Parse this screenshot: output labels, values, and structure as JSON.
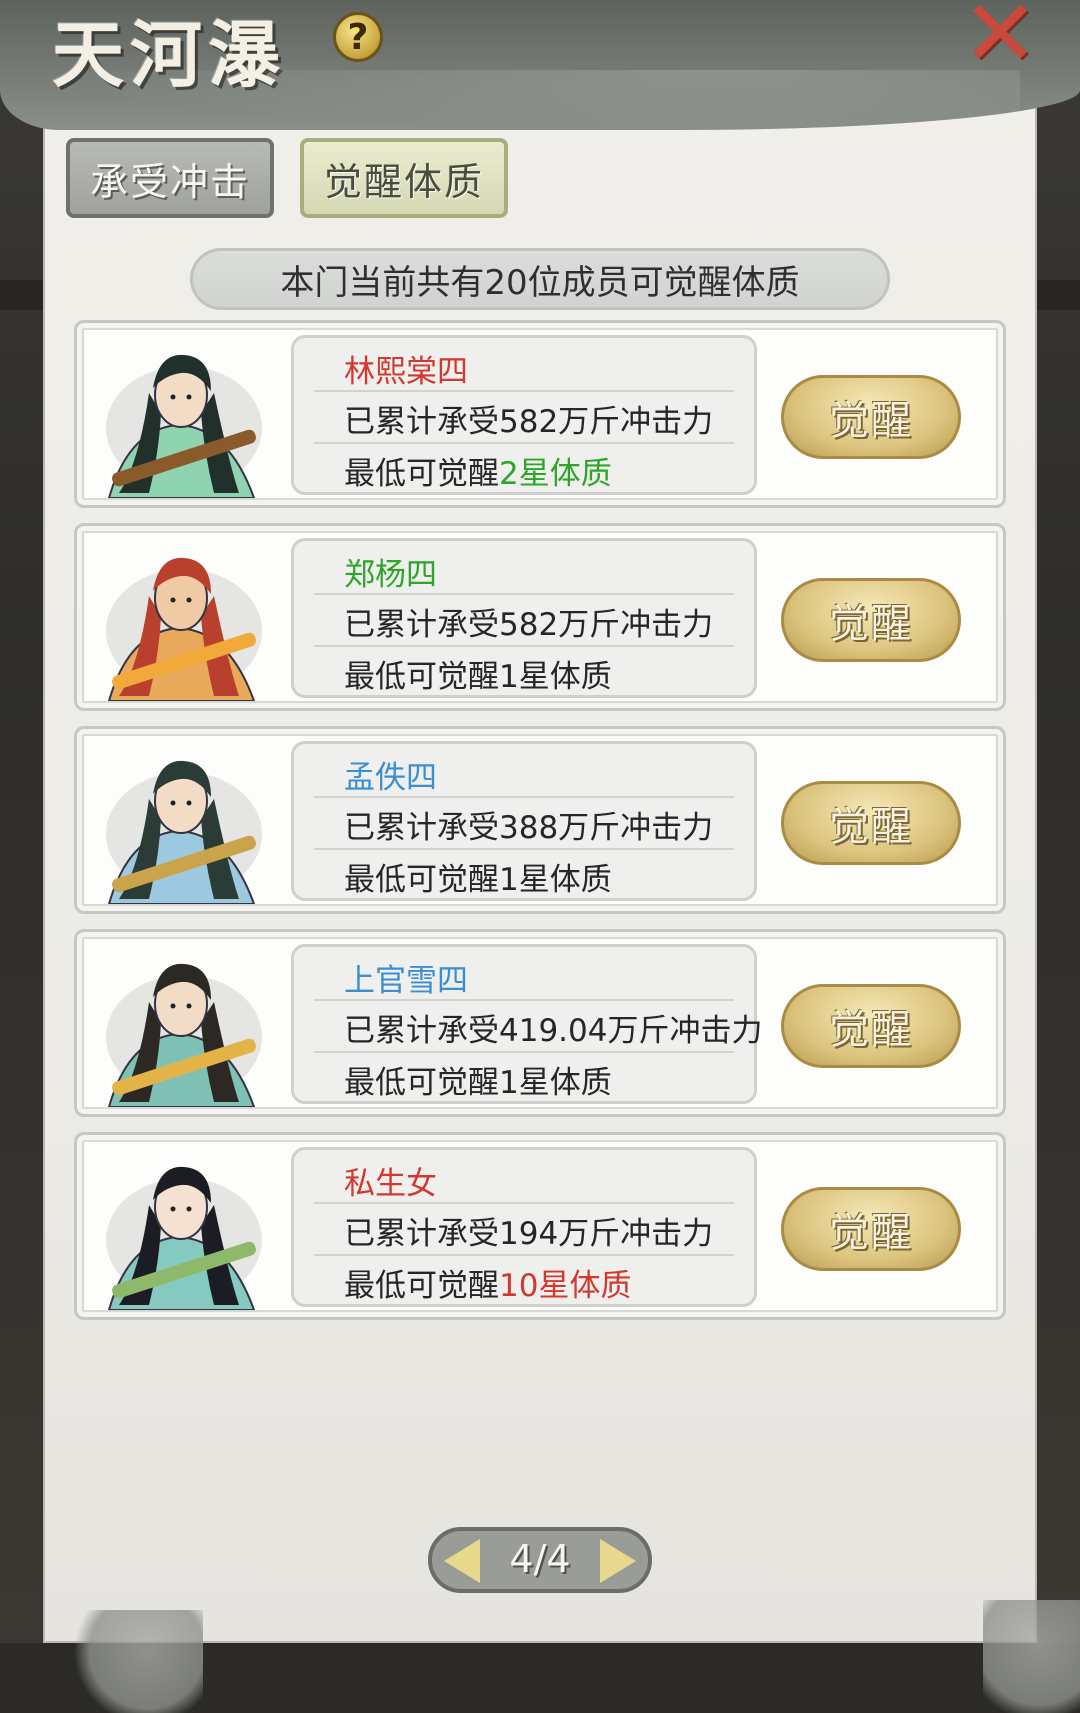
{
  "header": {
    "title": "天河瀑",
    "help_glyph": "?",
    "close_glyph": "✕"
  },
  "tabs": [
    {
      "label": "承受冲击",
      "selected": false
    },
    {
      "label": "觉醒体质",
      "selected": true
    }
  ],
  "summary": "本门当前共有20位成员可觉醒体质",
  "members": [
    {
      "name": "林熙棠四",
      "name_color": "#d2382e",
      "impact_prefix": "已累计承受",
      "impact_value": "582万斤",
      "impact_suffix": "冲击力",
      "min_prefix": "最低可觉醒",
      "min_value": "2星体质",
      "min_color": "#2fa42a",
      "button": "觉醒"
    },
    {
      "name": "郑杨四",
      "name_color": "#2fa42a",
      "impact_prefix": "已累计承受",
      "impact_value": "582万斤",
      "impact_suffix": "冲击力",
      "min_prefix": "最低可觉醒",
      "min_value": "1星体质",
      "min_color": "#262626",
      "button": "觉醒"
    },
    {
      "name": "孟佚四",
      "name_color": "#3b8fd0",
      "impact_prefix": "已累计承受",
      "impact_value": "388万斤",
      "impact_suffix": "冲击力",
      "min_prefix": "最低可觉醒",
      "min_value": "1星体质",
      "min_color": "#262626",
      "button": "觉醒"
    },
    {
      "name": "上官雪四",
      "name_color": "#3b8fd0",
      "impact_prefix": "已累计承受",
      "impact_value": "419.04万斤",
      "impact_suffix": "冲击力",
      "min_prefix": "最低可觉醒",
      "min_value": "1星体质",
      "min_color": "#262626",
      "button": "觉醒"
    },
    {
      "name": "私生女",
      "name_color": "#d2382e",
      "impact_prefix": "已累计承受",
      "impact_value": "194万斤",
      "impact_suffix": "冲击力",
      "min_prefix": "最低可觉醒",
      "min_value": "10星体质",
      "min_color": "#d2382e",
      "button": "觉醒"
    }
  ],
  "pager": {
    "label": "4/4"
  }
}
